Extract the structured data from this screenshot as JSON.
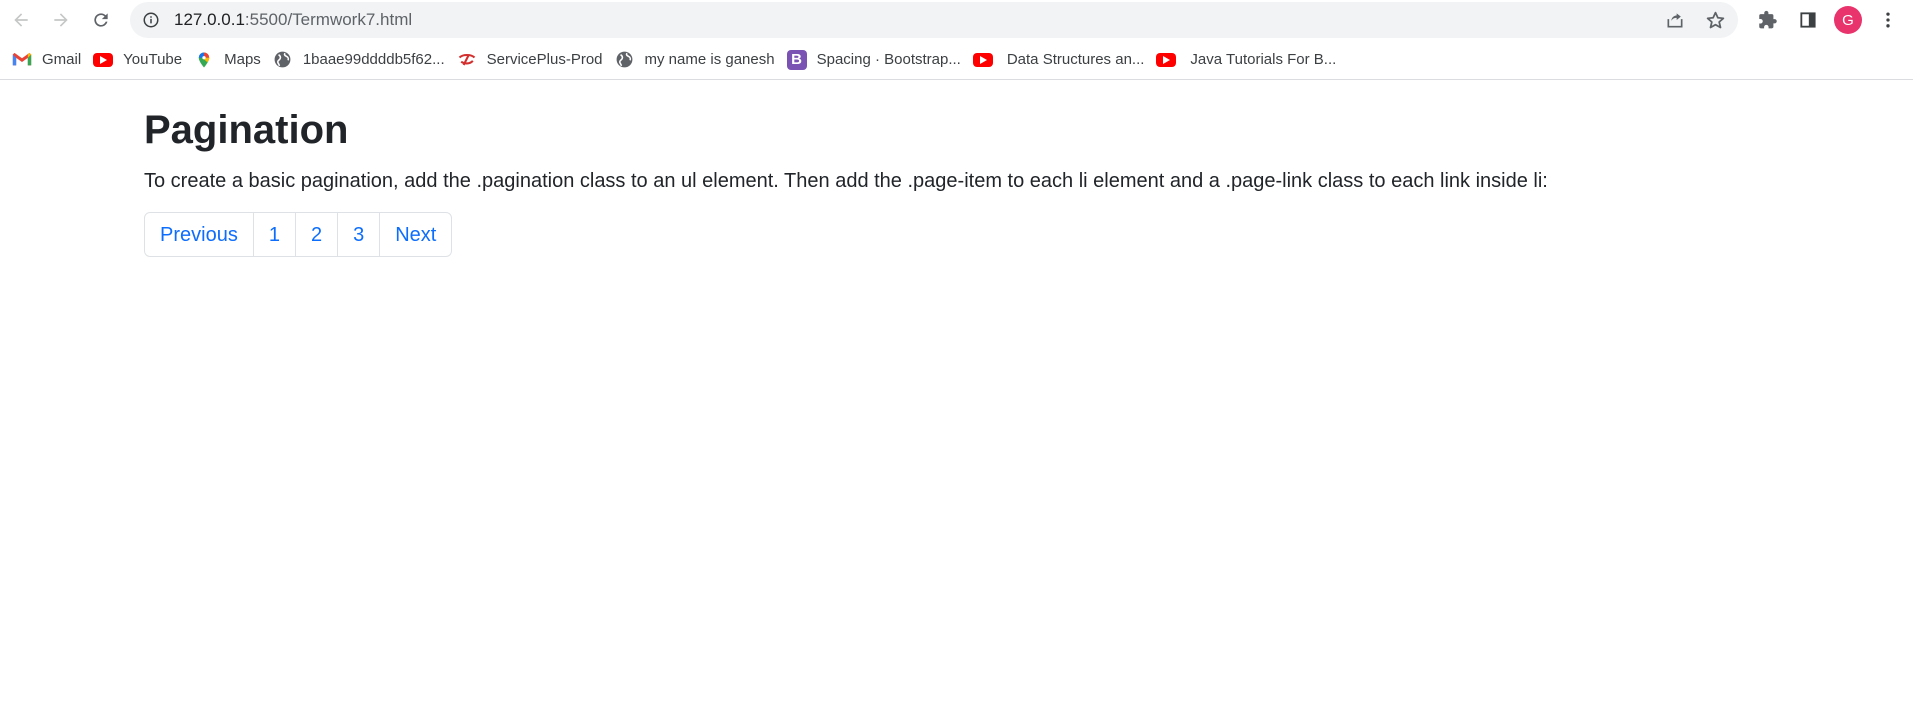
{
  "browser": {
    "url_host": "127.0.0.1",
    "url_path": ":5500/Termwork7.html",
    "profile_initial": "G",
    "icons": {
      "back": "arrow-left-icon",
      "forward": "arrow-right-icon",
      "reload": "reload-icon",
      "info": "info-icon",
      "share": "share-icon",
      "bookmark": "star-icon",
      "extensions": "puzzle-icon",
      "side_panel": "side-panel-icon",
      "menu": "kebab-menu-icon"
    }
  },
  "bookmarks": [
    {
      "label": "Gmail",
      "icon": "gmail-icon"
    },
    {
      "label": "YouTube",
      "icon": "youtube-icon"
    },
    {
      "label": "Maps",
      "icon": "maps-icon"
    },
    {
      "label": "1baae99ddddb5f62...",
      "icon": "globe-icon"
    },
    {
      "label": "ServicePlus-Prod",
      "icon": "serviceplus-icon"
    },
    {
      "label": "my name is ganesh",
      "icon": "globe-icon"
    },
    {
      "label": "Spacing · Bootstrap...",
      "icon": "bootstrap-icon"
    },
    {
      "label": "Data Structures an...",
      "icon": "youtube-icon"
    },
    {
      "label": "Java Tutorials For B...",
      "icon": "youtube-icon"
    }
  ],
  "page": {
    "title": "Pagination",
    "description": "To create a basic pagination, add the .pagination class to an ul element. Then add the .page-item to each li element and a .page-link class to each link inside li:",
    "pagination": [
      "Previous",
      "1",
      "2",
      "3",
      "Next"
    ]
  },
  "colors": {
    "link": "#0d6efd",
    "avatar": "#e8336d",
    "bootstrap_purple": "#7952b3",
    "youtube_red": "#ff0000"
  }
}
